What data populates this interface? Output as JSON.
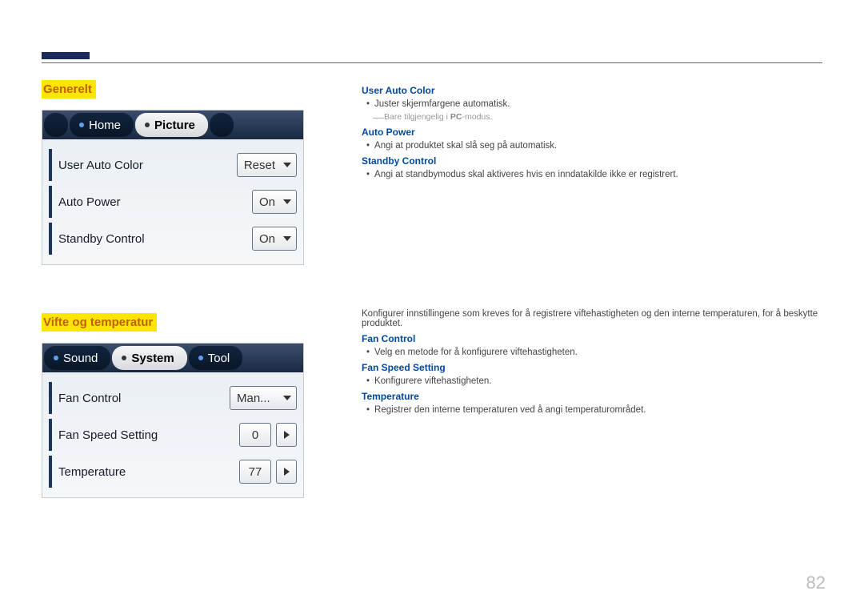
{
  "page_number": "82",
  "sections": {
    "generelt": {
      "title": "Generelt",
      "tabs": [
        "Home",
        "Picture"
      ],
      "rows": [
        {
          "label": "User Auto Color",
          "value": "Reset",
          "kind": "dropdown"
        },
        {
          "label": "Auto Power",
          "value": "On",
          "kind": "dropdown"
        },
        {
          "label": "Standby Control",
          "value": "On",
          "kind": "dropdown"
        }
      ],
      "desc": {
        "user_auto_color": {
          "heading": "User Auto Color",
          "bullets": [
            "Juster skjermfargene automatisk."
          ],
          "note_prefix": "Bare tilgjengelig i ",
          "note_bold": "PC",
          "note_suffix": "-modus."
        },
        "auto_power": {
          "heading": "Auto Power",
          "bullets": [
            "Angi at produktet skal slå seg på automatisk."
          ]
        },
        "standby_control": {
          "heading": "Standby Control",
          "bullets": [
            "Angi at standbymodus skal aktiveres hvis en inndatakilde ikke er registrert."
          ]
        }
      }
    },
    "vifte": {
      "title": "Vifte og temperatur",
      "tabs": [
        "Sound",
        "System",
        "Tool"
      ],
      "active_tab": "System",
      "rows": [
        {
          "label": "Fan Control",
          "value": "Man...",
          "kind": "dropdown"
        },
        {
          "label": "Fan Speed Setting",
          "value": "0",
          "kind": "spinner"
        },
        {
          "label": "Temperature",
          "value": "77",
          "kind": "spinner"
        }
      ],
      "desc": {
        "intro": "Konfigurer innstillingene som kreves for å registrere viftehastigheten og den interne temperaturen, for å beskytte produktet.",
        "fan_control": {
          "heading": "Fan Control",
          "bullets": [
            "Velg en metode for å konfigurere viftehastigheten."
          ]
        },
        "fan_speed_setting": {
          "heading": "Fan Speed Setting",
          "bullets": [
            "Konfigurere viftehastigheten."
          ]
        },
        "temperature": {
          "heading": "Temperature",
          "bullets": [
            "Registrer den interne temperaturen ved å angi temperaturområdet."
          ]
        }
      }
    }
  }
}
